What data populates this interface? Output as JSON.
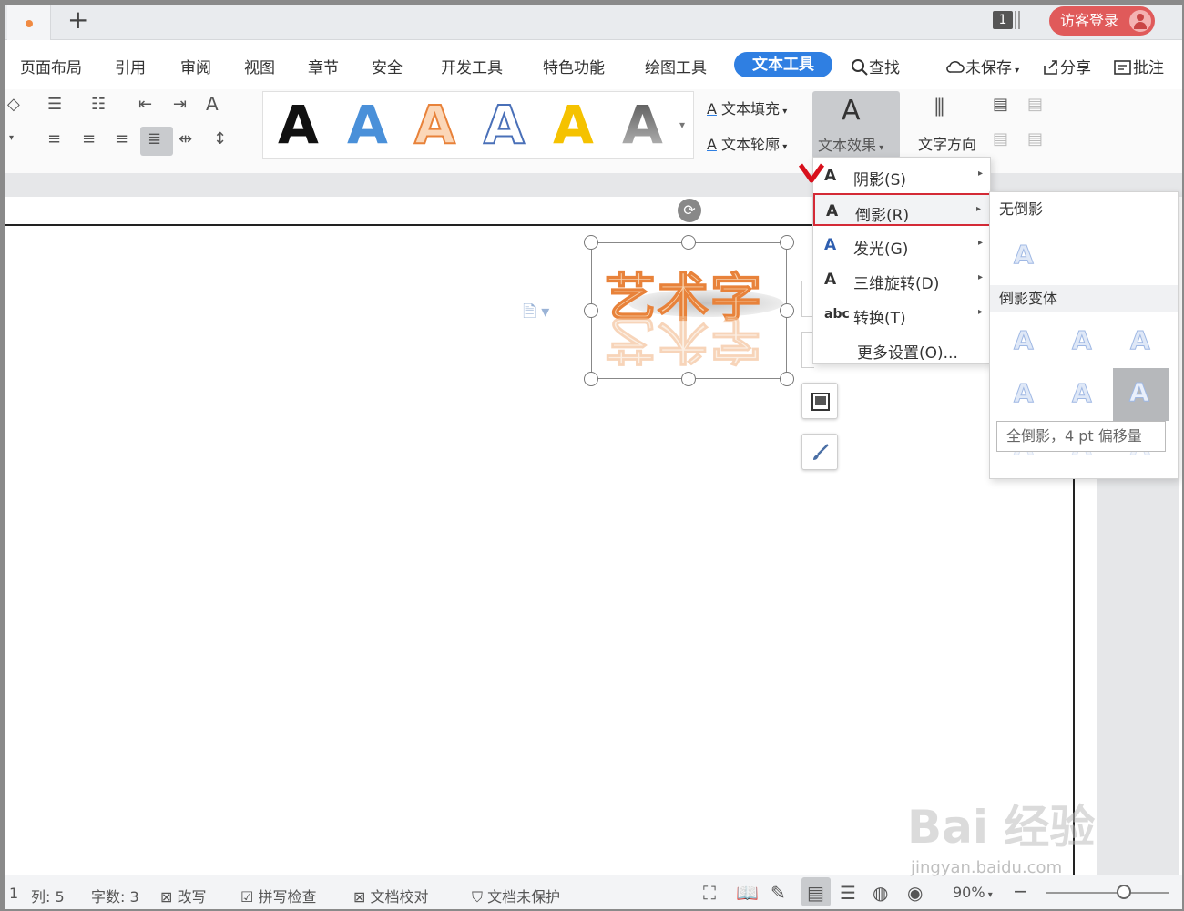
{
  "title_bar": {
    "new_tab_symbol": "+",
    "tab_count": "1",
    "login_label": "访客登录"
  },
  "menubar": {
    "items": [
      "页面布局",
      "引用",
      "审阅",
      "视图",
      "章节",
      "安全",
      "开发工具",
      "特色功能",
      "绘图工具",
      "文本工具"
    ],
    "active_item": "文本工具",
    "search_label": "查找",
    "unsaved_label": "未保存",
    "share_label": "分享",
    "comment_label": "批注"
  },
  "ribbon": {
    "wordart_styles": [
      {
        "glyph": "A",
        "color": "#111111"
      },
      {
        "glyph": "A",
        "color": "#4a90d9"
      },
      {
        "glyph": "A",
        "color": "#f0a060"
      },
      {
        "glyph": "A",
        "color": "#ffffff"
      },
      {
        "glyph": "A",
        "color": "#f5c200"
      },
      {
        "glyph": "A",
        "color": "#777777"
      }
    ],
    "text_fill_label": "文本填充",
    "text_outline_label": "文本轮廓",
    "text_effect_label": "文本效果",
    "text_direction_label": "文字方向"
  },
  "document": {
    "wordart_text": "艺术字"
  },
  "effects_menu": {
    "items": [
      {
        "icon": "A",
        "label": "阴影(S)",
        "has_submenu": true
      },
      {
        "icon": "A",
        "label": "倒影(R)",
        "has_submenu": true,
        "highlighted": true
      },
      {
        "icon": "A",
        "label": "发光(G)",
        "has_submenu": true
      },
      {
        "icon": "A",
        "label": "三维旋转(D)",
        "has_submenu": true
      },
      {
        "icon": "abc",
        "label": "转换(T)",
        "has_submenu": true
      },
      {
        "icon": "",
        "label": "更多设置(O)...",
        "has_submenu": false
      }
    ]
  },
  "reflection_submenu": {
    "no_reflection_heading": "无倒影",
    "variants_heading": "倒影变体",
    "tooltip": "全倒影，4 pt 偏移量"
  },
  "statusbar": {
    "line_fragment": "1",
    "column": "列: 5",
    "word_count": "字数: 3",
    "revise": "改写",
    "spell_check": "拼写检查",
    "proofread": "文档校对",
    "protection": "文档未保护",
    "zoom": "90%"
  },
  "watermark": {
    "brand": "Bai 经验",
    "url": "jingyan.baidu.com"
  },
  "colors": {
    "accent": "#2f7fe2",
    "highlight_border": "#d42a36",
    "login_bg": "#e05a5a",
    "wordart_outline": "#e8823a"
  }
}
